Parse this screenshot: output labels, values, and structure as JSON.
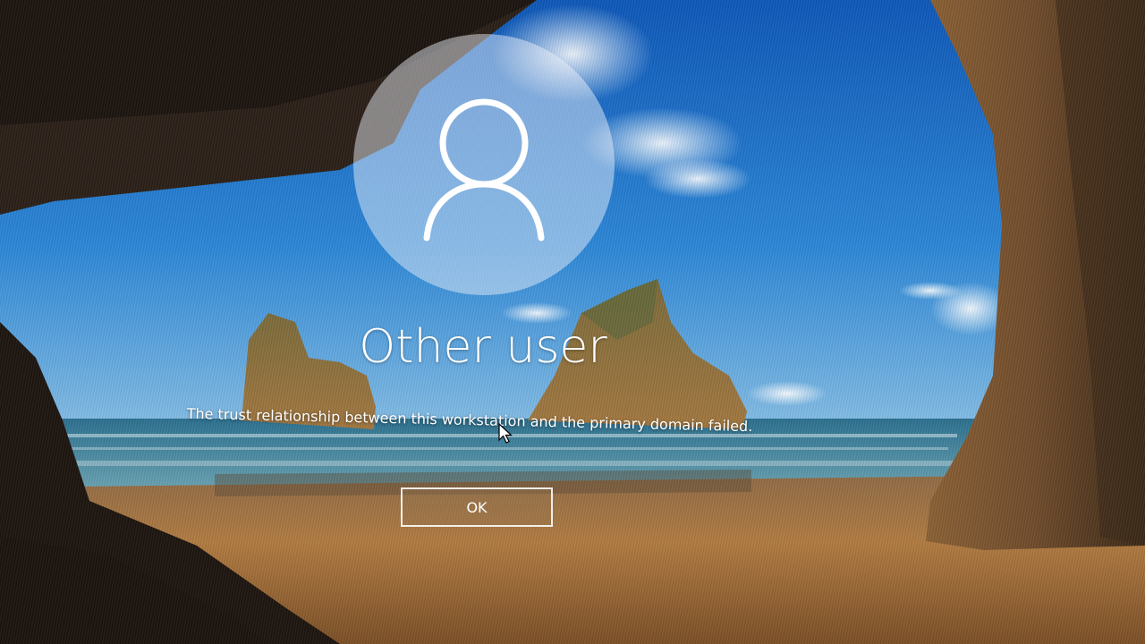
{
  "user": {
    "name": "Other user",
    "avatar_icon": "user-silhouette-icon"
  },
  "dialog": {
    "message": "The trust relationship between this workstation and the primary domain failed.",
    "ok_label": "OK"
  },
  "cursor_icon": "mouse-pointer-icon",
  "colors": {
    "sky": "#1f6fc4",
    "sea": "#2f7c9a",
    "sand": "#b07a40",
    "rock": "#3a2a1c",
    "text": "#ffffff"
  }
}
